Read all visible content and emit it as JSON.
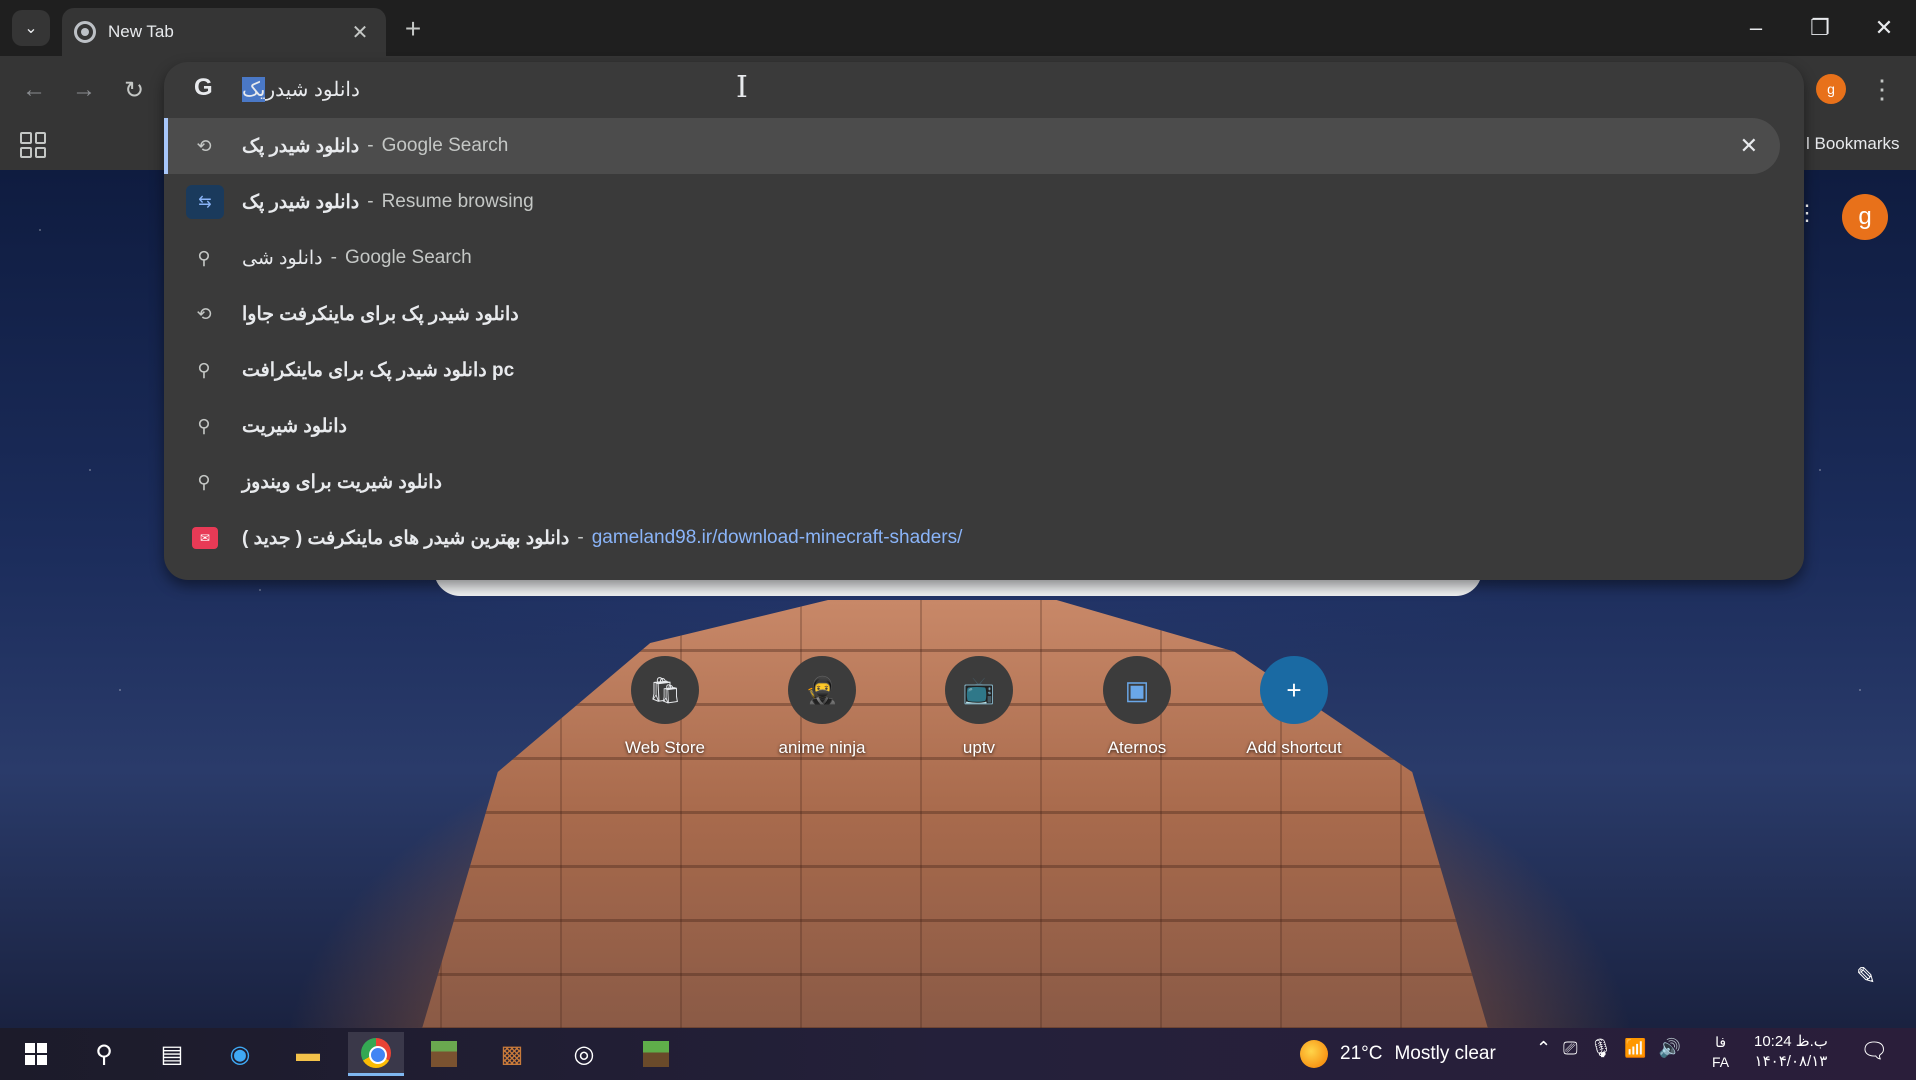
{
  "tab": {
    "title": "New Tab",
    "close": "✕"
  },
  "window": {
    "new_tab": "+",
    "minimize": "–",
    "restore": "❐",
    "close": "✕"
  },
  "toolbar": {
    "back": "←",
    "forward": "→",
    "reload": "↻",
    "profile_initial": "g",
    "menu": "⋮"
  },
  "omnibox": {
    "g_logo": "G",
    "input_selected": "یک",
    "input_rest": "دانلود شیدر ",
    "cursor": "I"
  },
  "suggestions": [
    {
      "icon": "history-icon",
      "glyph": "⟲",
      "query": "دانلود شیدر پک",
      "meta": "Google Search",
      "sep": "-",
      "url": "",
      "remove": "✕"
    },
    {
      "icon": "tab-icon",
      "glyph": "⇆",
      "query": "دانلود شیدر پک",
      "meta": "Resume browsing",
      "sep": "-",
      "url": "",
      "remove": ""
    },
    {
      "icon": "search-icon",
      "glyph": "⚲",
      "query": "دانلود شی",
      "meta": "Google Search",
      "sep": "-",
      "url": "",
      "remove": ""
    },
    {
      "icon": "history-icon",
      "glyph": "⟲",
      "query": "دانلود شیدر پک برای ماینکرفت جاوا",
      "meta": "",
      "sep": "",
      "url": "",
      "remove": ""
    },
    {
      "icon": "search-icon",
      "glyph": "⚲",
      "query": "دانلود شیدر پک برای ماینکرافت pc",
      "meta": "",
      "sep": "",
      "url": "",
      "remove": ""
    },
    {
      "icon": "search-icon",
      "glyph": "⚲",
      "query": "دانلود شیریت",
      "meta": "",
      "sep": "",
      "url": "",
      "remove": ""
    },
    {
      "icon": "search-icon",
      "glyph": "⚲",
      "query": "دانلود شیریت برای ویندوز",
      "meta": "",
      "sep": "",
      "url": "",
      "remove": ""
    },
    {
      "icon": "site-favicon-icon",
      "glyph": "✉",
      "query": "دانلود بهترین شیدر های ماینکرفت ( جدید )",
      "meta": "",
      "sep": "-",
      "url": "gameland98.ir/download-minecraft-shaders/",
      "remove": ""
    }
  ],
  "bookmarks": {
    "label": "l Bookmarks"
  },
  "ntp": {
    "avatar": "g",
    "dots": "⋮",
    "pencil": "✎",
    "shortcuts": [
      {
        "label": "Web Store",
        "glyph": "🛍"
      },
      {
        "label": "anime ninja",
        "glyph": "🥷"
      },
      {
        "label": "uptv",
        "glyph": "📺"
      },
      {
        "label": "Aternos",
        "glyph": "▣"
      },
      {
        "label": "Add shortcut",
        "glyph": "+"
      }
    ]
  },
  "taskbar": {
    "temp": "21°C",
    "weather": "Mostly clear",
    "lang_top": "فا",
    "lang_bottom": "FA",
    "time": "10:24 ب.ظ",
    "date": "۱۴۰۴/۰۸/۱۳"
  }
}
